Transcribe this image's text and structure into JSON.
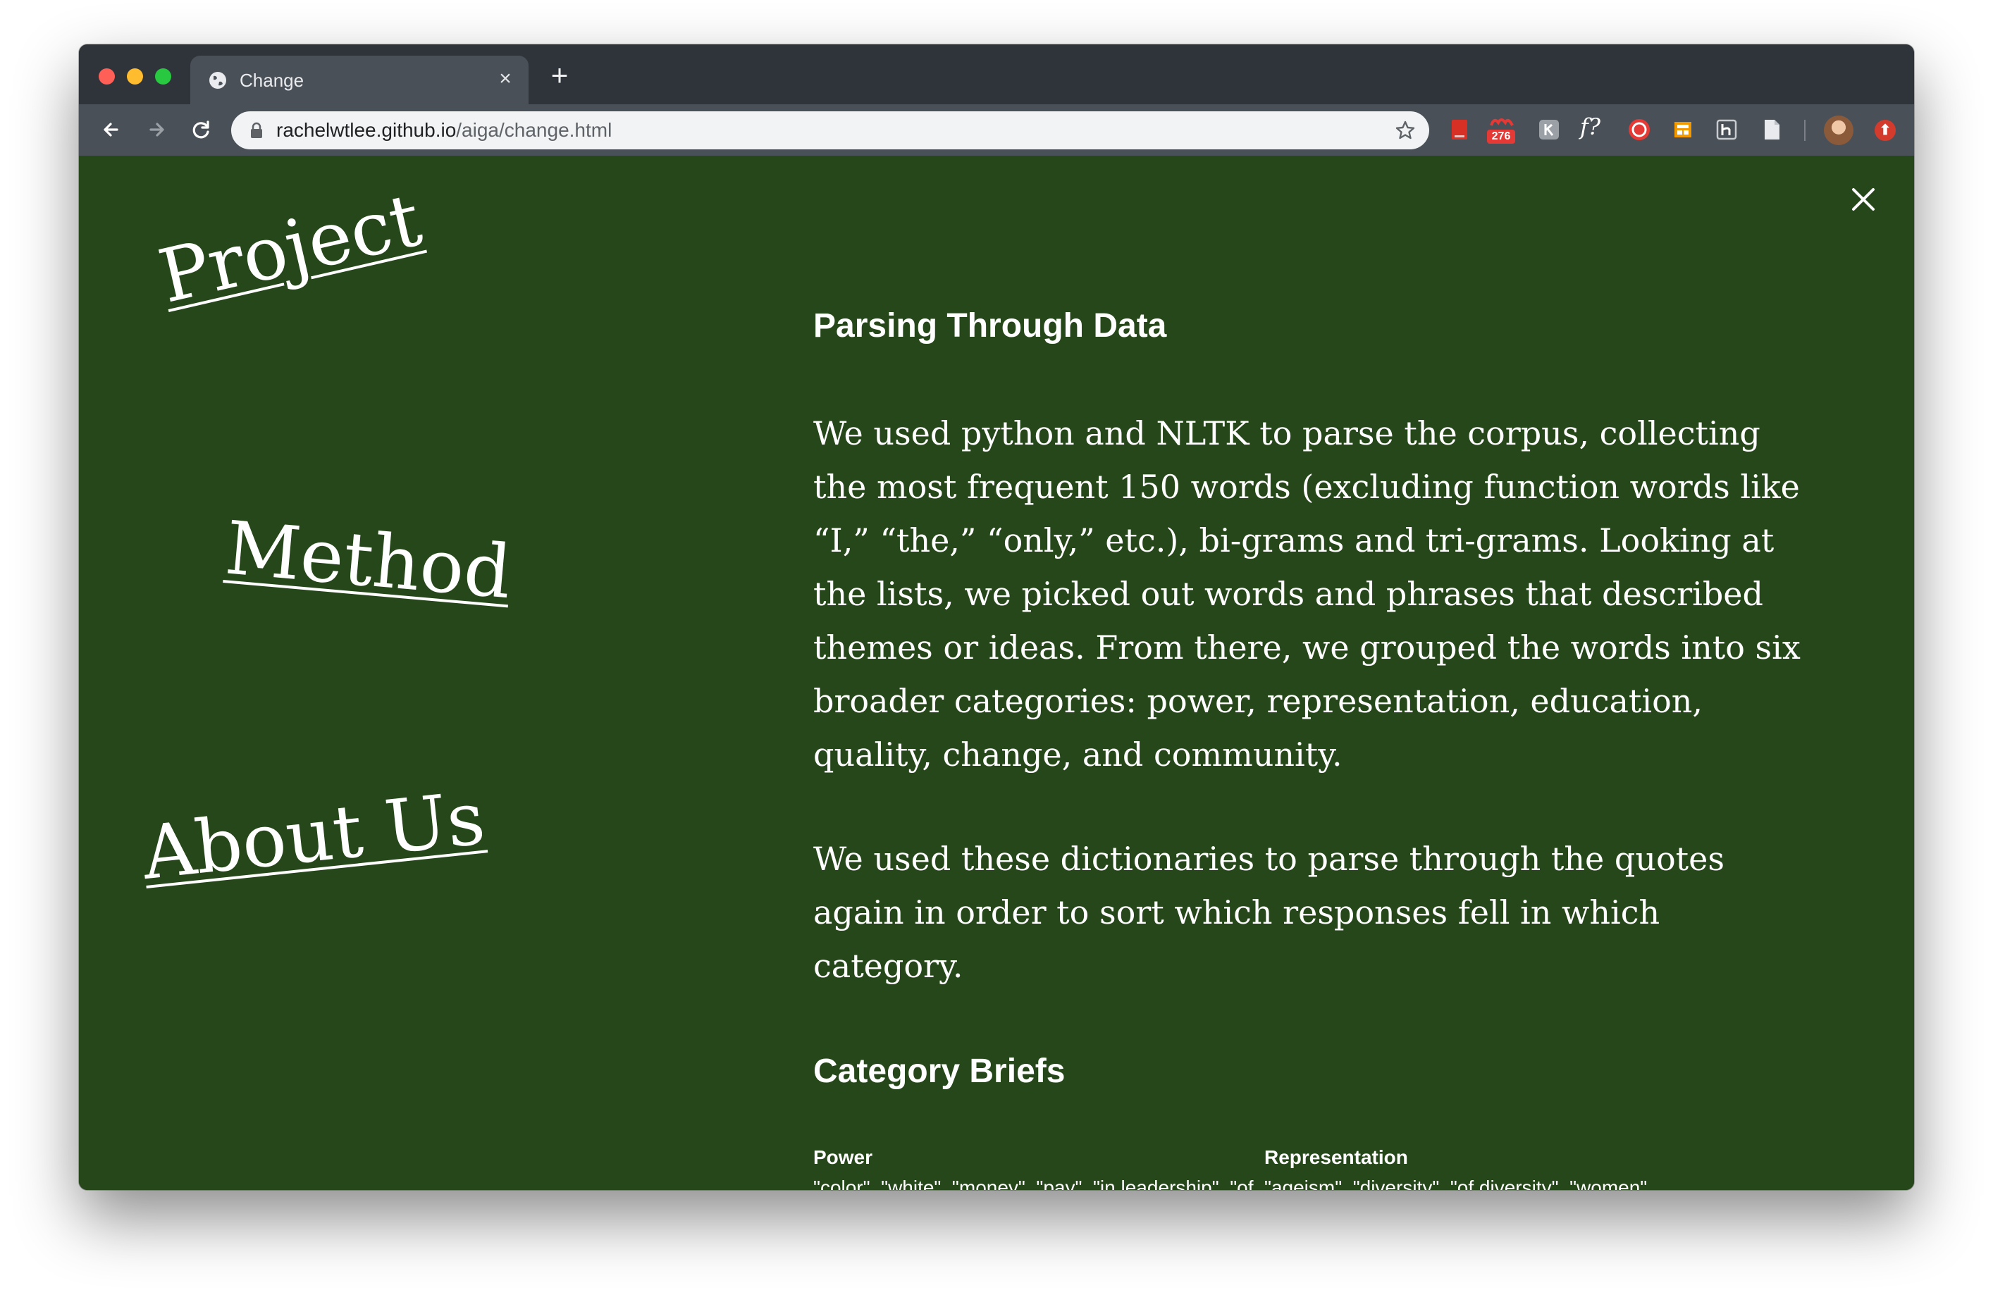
{
  "browser": {
    "tab_title": "Change",
    "url_host": "rachelwtlee.github.io",
    "url_path": "/aiga/change.html",
    "extension_badge": "276",
    "extension_f_label": "f?",
    "icons": [
      "globe-icon",
      "close-icon",
      "plus-icon",
      "back-icon",
      "forward-icon",
      "reload-icon",
      "lock-icon",
      "star-icon",
      "pdf-extension-icon",
      "badge-extension-icon",
      "k-extension-icon",
      "f-extension-icon",
      "stop-extension-icon",
      "layout-extension-icon",
      "h-extension-icon",
      "document-extension-icon",
      "avatar",
      "update-icon"
    ]
  },
  "sidebar": {
    "links": [
      "Project",
      "Method",
      "About Us"
    ]
  },
  "content": {
    "heading_1": "Parsing Through Data",
    "paragraph_1": "We used python and NLTK to parse the corpus, collecting the most frequent 150 words (excluding function words like “I,” “the,” “only,” etc.), bi-grams and tri-grams. Looking at the lists, we picked out words and phrases that described themes or ideas. From there, we grouped the words into six broader categories: power, representation, education, quality, change, and community.",
    "paragraph_2": "We used these dictionaries to parse through the quotes again in order to sort which responses fell in which category.",
    "heading_2": "Category Briefs",
    "briefs": [
      {
        "title": "Power",
        "words": "\"color\", \"white\", \"money\", \"pay\", \"in leadership\", \"of color\", \"of diversity\""
      },
      {
        "title": "Representation",
        "words": "\"ageism\", \"diversity\", \"of diversity\", \"women\", \"woman\", \"standards\", \"a seat\", \"of respect for\""
      }
    ]
  },
  "colors": {
    "page_background": "#26471a",
    "text": "#ffffff",
    "tabstrip": "#2f343b",
    "toolbar": "#4a5058"
  }
}
